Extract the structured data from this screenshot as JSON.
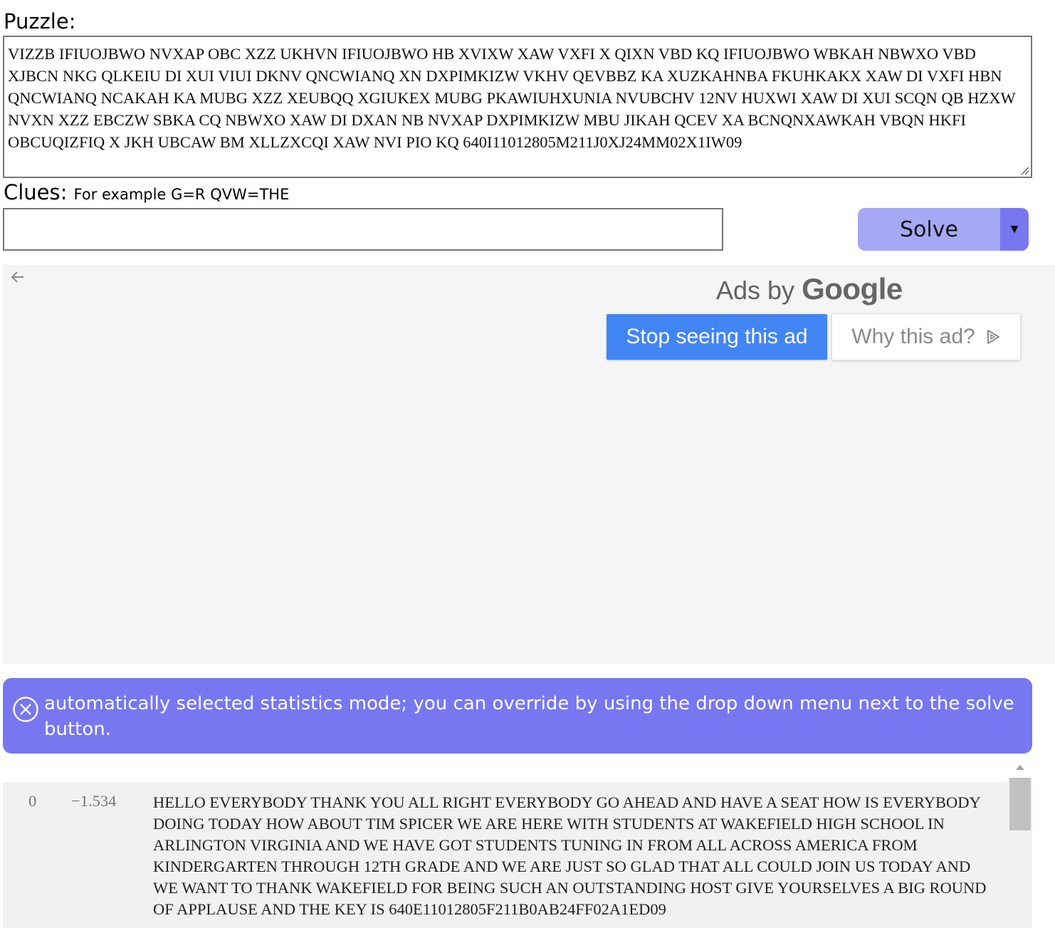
{
  "puzzle": {
    "label": "Puzzle:",
    "text": "VIZZB IFIUOJBWO NVXAP OBC XZZ UKHVN IFIUOJBWO HB XVIXW XAW VXFI X QIXN VBD KQ IFIUOJBWO WBKAH NBWXO VBD\nXJBCN NKG QLKEIU DI XUI VIUI DKNV QNCWIANQ XN DXPIMKIZW VKHV QEVBBZ KA XUZKAHNBA FKUHKAKX XAW DI VXFI HBN\nQNCWIANQ NCAKAH KA MUBG XZZ XEUBQQ XGIUKEX MUBG PKAWIUHXUNIA NVUBCHV 12NV HUXWI XAW DI XUI SCQN QB HZXW\nNVXN XZZ EBCZW SBKA CQ NBWXO XAW DI DXAN NB NVXAP DXPIMKIZW MBU JIKAH QCEV XA BCNQNXAWKAH VBQN HKFI\nOBCUQIZFIQ X JKH UBCAW BM XLLZXCQI XAW NVI PIO KQ 640I11012805M211J0XJ24MM02X1IW09"
  },
  "clues": {
    "label": "Clues:",
    "hint": "For example G=R QVW=THE",
    "value": ""
  },
  "solve": {
    "label": "Solve",
    "dropdown_glyph": "▼"
  },
  "ad": {
    "ads_by": "Ads by",
    "google": "Google",
    "stop_label": "Stop seeing this ad",
    "why_label": "Why this ad?"
  },
  "notice": {
    "message": "automatically selected statistics mode; you can override by using the drop down menu next to the solve button."
  },
  "results": [
    {
      "index": "0",
      "score": "−1.534",
      "text": "HELLO EVERYBODY THANK YOU ALL RIGHT EVERYBODY GO AHEAD AND HAVE A SEAT HOW IS EVERYBODY\nDOING TODAY HOW ABOUT TIM SPICER WE ARE HERE WITH STUDENTS AT WAKEFIELD HIGH SCHOOL IN\nARLINGTON VIRGINIA AND WE HAVE GOT STUDENTS TUNING IN FROM ALL ACROSS AMERICA FROM\nKINDERGARTEN THROUGH 12TH GRADE AND WE ARE JUST SO GLAD THAT ALL COULD JOIN US TODAY AND\nWE WANT TO THANK WAKEFIELD FOR BEING SUCH AN OUTSTANDING HOST GIVE YOURSELVES A BIG ROUND\nOF APPLAUSE AND THE KEY IS 640E11012805F211B0AB24FF02A1ED09"
    }
  ],
  "colors": {
    "solve_button": "#a5a8f4",
    "solve_dropdown": "#7777f2",
    "notice_bg": "#7777f2",
    "ad_bg": "#f5f5f5",
    "stop_ad_bg": "#4285f4",
    "result_row_bg": "#f1f1f1"
  },
  "icons": {
    "notice": "close-circle-icon",
    "ad_back": "arrow-left-icon",
    "why_ad": "adchoices-icon",
    "resize": "resize-grip-icon",
    "scroll_up": "scroll-up-arrow-icon"
  }
}
